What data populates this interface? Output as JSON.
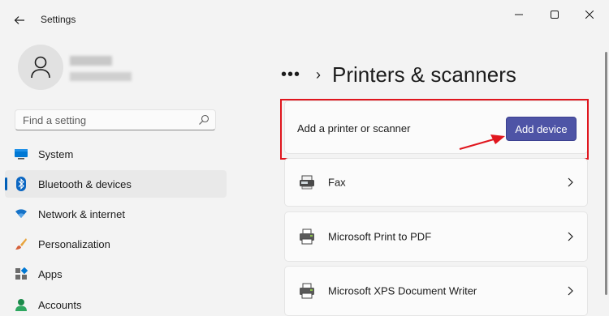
{
  "window": {
    "title": "Settings",
    "controls": [
      "minimize",
      "maximize",
      "close"
    ]
  },
  "profile": {
    "name_blurred": true,
    "email_blurred": true
  },
  "search": {
    "placeholder": "Find a setting"
  },
  "sidebar": {
    "items": [
      {
        "label": "System",
        "icon": "monitor-icon",
        "active": false
      },
      {
        "label": "Bluetooth & devices",
        "icon": "bluetooth-icon",
        "active": true
      },
      {
        "label": "Network & internet",
        "icon": "wifi-icon",
        "active": false
      },
      {
        "label": "Personalization",
        "icon": "brush-icon",
        "active": false
      },
      {
        "label": "Apps",
        "icon": "apps-icon",
        "active": false
      },
      {
        "label": "Accounts",
        "icon": "person-icon",
        "active": false
      }
    ]
  },
  "main": {
    "breadcrumb_dots": "•••",
    "title": "Printers & scanners",
    "add_section": {
      "label": "Add a printer or scanner",
      "button_label": "Add device"
    },
    "devices": [
      {
        "label": "Fax",
        "icon": "fax-icon"
      },
      {
        "label": "Microsoft Print to PDF",
        "icon": "printer-icon"
      },
      {
        "label": "Microsoft XPS Document Writer",
        "icon": "printer-icon"
      }
    ]
  },
  "colors": {
    "accent": "#005fb8",
    "button": "#4e54a6",
    "highlight": "#e0161e",
    "background": "#f3f3f3",
    "card": "#fbfbfb"
  }
}
